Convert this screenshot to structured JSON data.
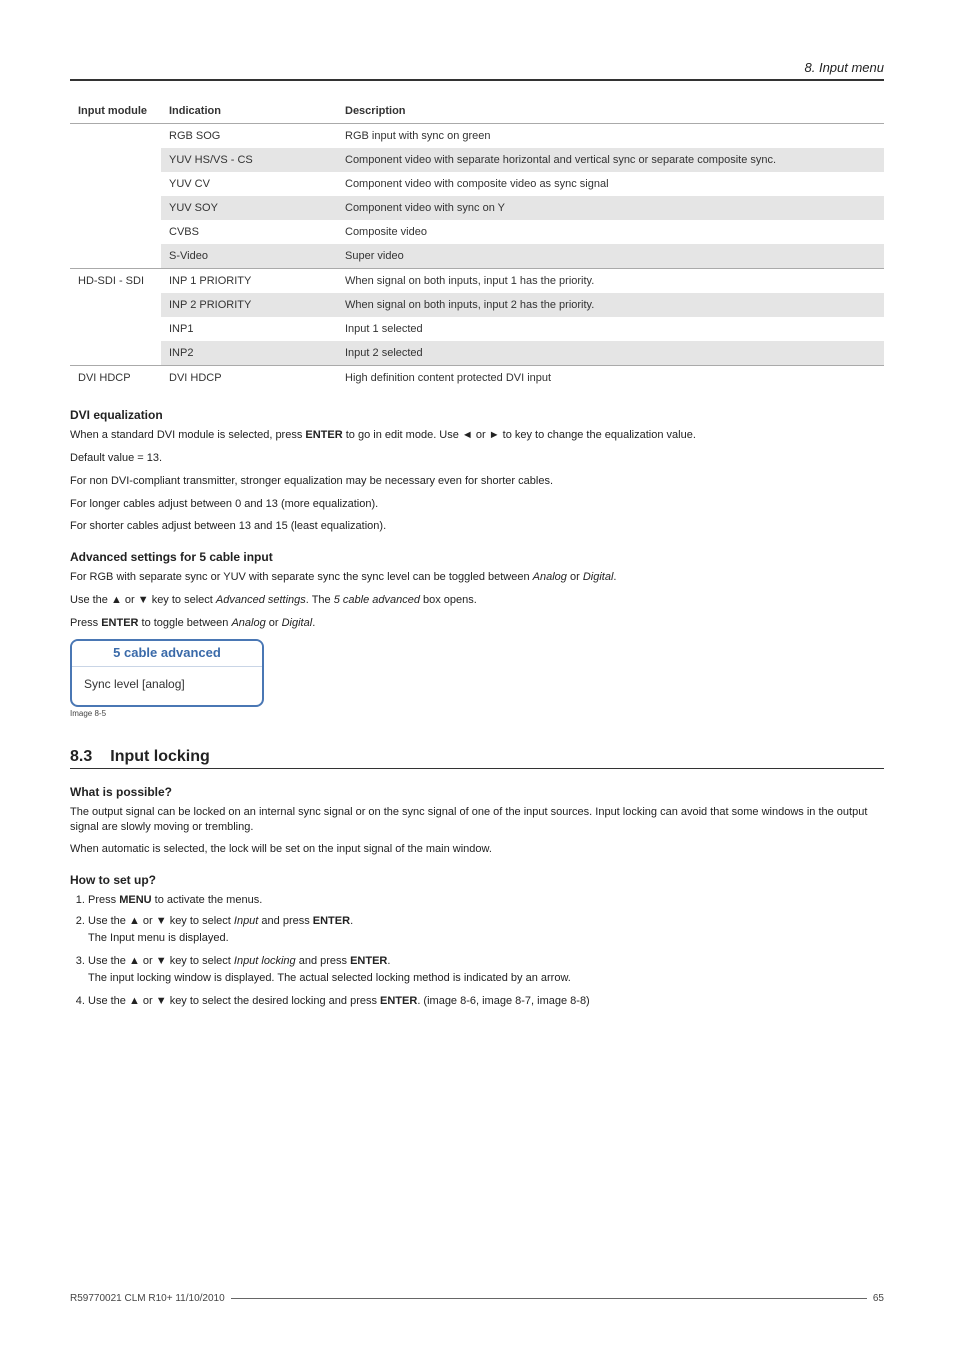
{
  "header": {
    "chapter": "8.  Input menu"
  },
  "table": {
    "headers": {
      "col1": "Input module",
      "col2": "Indication",
      "col3": "Description"
    },
    "group1": {
      "module": "",
      "rows": [
        {
          "ind": "RGB SOG",
          "desc": "RGB input with sync on green"
        },
        {
          "ind": "YUV HS/VS - CS",
          "desc": "Component video with separate horizontal and vertical sync or separate composite sync."
        },
        {
          "ind": "YUV CV",
          "desc": "Component video with composite video as sync signal"
        },
        {
          "ind": "YUV SOY",
          "desc": "Component video with sync on Y"
        },
        {
          "ind": "CVBS",
          "desc": "Composite video"
        },
        {
          "ind": "S-Video",
          "desc": "Super video"
        }
      ]
    },
    "group2": {
      "module": "HD-SDI - SDI",
      "rows": [
        {
          "ind": "INP 1 PRIORITY",
          "desc": "When signal on both inputs, input 1 has the priority."
        },
        {
          "ind": "INP 2 PRIORITY",
          "desc": "When signal on both inputs, input 2 has the priority."
        },
        {
          "ind": "INP1",
          "desc": "Input 1 selected"
        },
        {
          "ind": "INP2",
          "desc": "Input 2 selected"
        }
      ]
    },
    "group3": {
      "module": "DVI HDCP",
      "rows": [
        {
          "ind": "DVI HDCP",
          "desc": "High definition content protected DVI input"
        }
      ]
    }
  },
  "dvi_eq": {
    "heading": "DVI equalization",
    "p1a": "When a standard DVI module is selected, press ",
    "p1b": "ENTER",
    "p1c": " to go in edit mode. Use ◄ or ► to key to change the equalization value.",
    "p2": "Default value = 13.",
    "p3": "For non DVI-compliant transmitter, stronger equalization may be necessary even for shorter cables.",
    "p4": "For longer cables adjust between 0 and 13 (more equalization).",
    "p5": "For shorter cables adjust between 13 and 15 (least equalization)."
  },
  "adv": {
    "heading": "Advanced settings for 5 cable input",
    "p1a": "For RGB with separate sync or YUV with separate sync the sync level can be toggled between ",
    "p1b": "Analog",
    "p1c": " or ",
    "p1d": "Digital",
    "p1e": ".",
    "p2a": "Use the ▲ or ▼ key to select ",
    "p2b": "Advanced settings",
    "p2c": ". The ",
    "p2d": "5 cable advanced",
    "p2e": " box opens.",
    "p3a": "Press ",
    "p3b": "ENTER",
    "p3c": " to toggle between ",
    "p3d": "Analog",
    "p3e": " or ",
    "p3f": "Digital",
    "p3g": "."
  },
  "dialog": {
    "title": "5 cable advanced",
    "body": "Sync level [analog]",
    "caption": "Image 8-5"
  },
  "section": {
    "num": "8.3",
    "title": "Input locking",
    "what_h": "What is possible?",
    "what_p1": "The output signal can be locked on an internal sync signal or on the sync signal of one of the input sources. Input locking can avoid that some windows in the output signal are slowly moving or trembling.",
    "what_p2": "When automatic is selected, the lock will be set on the input signal of the main window.",
    "how_h": "How to set up?",
    "steps": {
      "s1a": "Press ",
      "s1b": "MENU",
      "s1c": " to activate the menus.",
      "s2a": "Use the ▲ or ▼ key to select ",
      "s2b": "Input",
      "s2c": " and press ",
      "s2d": "ENTER",
      "s2e": ".",
      "s2note": "The Input menu is displayed.",
      "s3a": "Use the ▲ or ▼ key to select ",
      "s3b": "Input locking",
      "s3c": " and press ",
      "s3d": "ENTER",
      "s3e": ".",
      "s3note": "The input locking window is displayed. The actual selected locking method is indicated by an arrow.",
      "s4a": "Use the ▲ or ▼ key to select the desired locking and press ",
      "s4b": "ENTER",
      "s4c": ". (image 8-6, image 8-7, image 8-8)"
    }
  },
  "footer": {
    "left": "R59770021  CLM R10+  11/10/2010",
    "right": "65"
  }
}
